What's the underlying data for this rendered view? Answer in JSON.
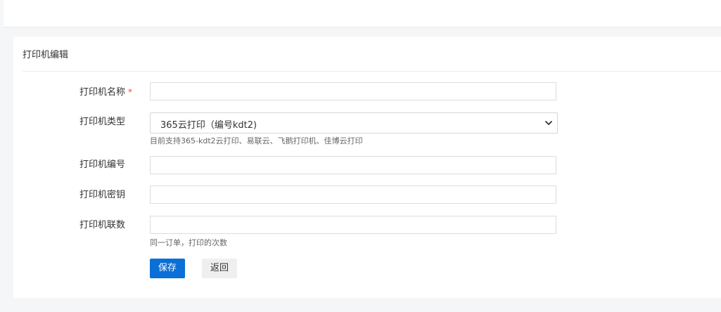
{
  "panel": {
    "title": "打印机编辑"
  },
  "form": {
    "name": {
      "label": "打印机名称",
      "required_mark": "*",
      "value": "",
      "placeholder": ""
    },
    "type": {
      "label": "打印机类型",
      "selected": "365云打印（编号kdt2)",
      "hint": "目前支持365-kdt2云打印、易联云、飞鹅打印机、佳博云打印"
    },
    "number": {
      "label": "打印机编号",
      "value": "",
      "placeholder": ""
    },
    "secret": {
      "label": "打印机密钥",
      "value": "",
      "placeholder": ""
    },
    "copies": {
      "label": "打印机联数",
      "value": "",
      "placeholder": "",
      "hint": "同一订单，打印的次数"
    }
  },
  "actions": {
    "save_label": "保存",
    "back_label": "返回"
  },
  "icons": {
    "select_arrow": "chevron-down-icon"
  },
  "colors": {
    "primary": "#0a6fd6",
    "required": "#e74c3c",
    "background": "#f5f6f8"
  }
}
